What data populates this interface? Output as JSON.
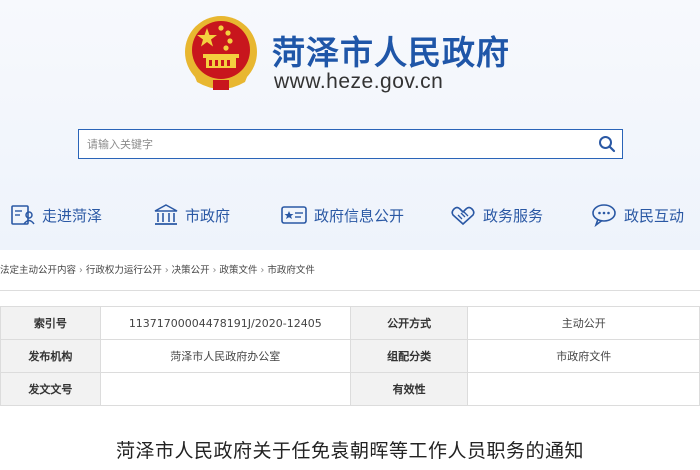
{
  "header": {
    "site_title": "菏泽市人民政府",
    "site_url": "www.heze.gov.cn",
    "emblem_icon": "national-emblem-icon"
  },
  "search": {
    "placeholder": "请输入关键字",
    "button_icon": "search-icon"
  },
  "nav": {
    "items": [
      {
        "label": "走进菏泽",
        "icon": "document-person-icon"
      },
      {
        "label": "市政府",
        "icon": "government-building-icon"
      },
      {
        "label": "政府信息公开",
        "icon": "info-card-icon"
      },
      {
        "label": "政务服务",
        "icon": "handshake-icon"
      },
      {
        "label": "政民互动",
        "icon": "chat-bubble-icon"
      }
    ]
  },
  "breadcrumb": {
    "items": [
      "法定主动公开内容",
      "行政权力运行公开",
      "决策公开",
      "政策文件",
      "市政府文件"
    ],
    "separator": "›"
  },
  "meta_table": {
    "rows": [
      {
        "k1": "索引号",
        "v1": "11371700004478191J/2020-12405",
        "k2": "公开方式",
        "v2": "主动公开"
      },
      {
        "k1": "发布机构",
        "v1": "菏泽市人民政府办公室",
        "k2": "组配分类",
        "v2": "市政府文件"
      },
      {
        "k1": "发文文号",
        "v1": "",
        "k2": "有效性",
        "v2": ""
      }
    ]
  },
  "document": {
    "title": "菏泽市人民政府关于任免袁朝晖等工作人员职务的通知"
  },
  "colors": {
    "brand_blue": "#1f56a8",
    "emblem_red": "#c8161d",
    "emblem_gold": "#e8b730"
  }
}
